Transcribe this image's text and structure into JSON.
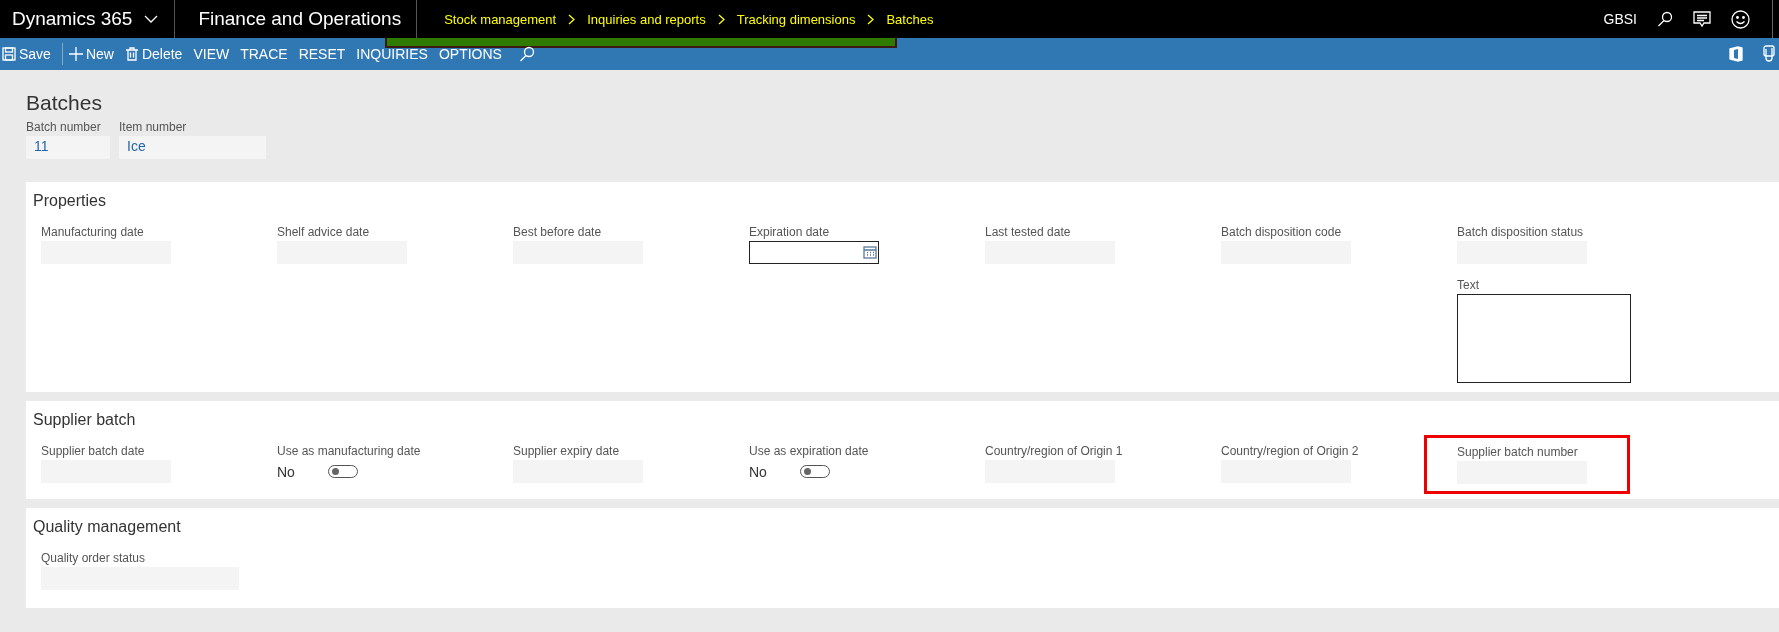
{
  "nav": {
    "app": "Dynamics 365",
    "module": "Finance and Operations",
    "breadcrumb": [
      "Stock management",
      "Inquiries and reports",
      "Tracking dimensions",
      "Batches"
    ],
    "user": "GBSI"
  },
  "toolbar": [
    {
      "label": "Save",
      "kind": "save"
    },
    {
      "label": "New",
      "kind": "new"
    },
    {
      "label": "Delete",
      "kind": "delete"
    },
    {
      "label": "VIEW",
      "kind": "menu"
    },
    {
      "label": "TRACE",
      "kind": "menu"
    },
    {
      "label": "RESET",
      "kind": "menu"
    },
    {
      "label": "INQUIRIES",
      "kind": "menu"
    },
    {
      "label": "OPTIONS",
      "kind": "menu"
    }
  ],
  "page_title": "Batches",
  "header_fields": [
    {
      "label": "Batch number",
      "value": "11"
    },
    {
      "label": "Item number",
      "value": "Ice"
    }
  ],
  "sections": [
    {
      "title": "Properties",
      "fields": [
        {
          "label": "Manufacturing date",
          "kind": "text",
          "highlighted": false
        },
        {
          "label": "Shelf advice date",
          "kind": "text",
          "highlighted": false
        },
        {
          "label": "Best before date",
          "kind": "text",
          "highlighted": false
        },
        {
          "label": "Expiration date",
          "kind": "date",
          "highlighted": false
        },
        {
          "label": "Last tested date",
          "kind": "text",
          "highlighted": false
        },
        {
          "label": "Batch disposition code",
          "kind": "text",
          "highlighted": false
        },
        {
          "label": "Batch disposition status",
          "kind": "text",
          "highlighted": false,
          "extra": {
            "label": "Text",
            "kind": "textarea"
          }
        }
      ]
    },
    {
      "title": "Supplier batch",
      "fields": [
        {
          "label": "Supplier batch date",
          "kind": "text",
          "highlighted": false
        },
        {
          "label": "Use as manufacturing date",
          "kind": "toggle",
          "value": "No",
          "on": false,
          "highlighted": false
        },
        {
          "label": "Supplier expiry date",
          "kind": "text",
          "highlighted": false
        },
        {
          "label": "Use as expiration date",
          "kind": "toggle",
          "value": "No",
          "on": false,
          "highlighted": false
        },
        {
          "label": "Country/region of Origin 1",
          "kind": "text",
          "highlighted": false
        },
        {
          "label": "Country/region of Origin 2",
          "kind": "text",
          "highlighted": false
        },
        {
          "label": "Supplier batch number",
          "kind": "text",
          "highlighted": true
        }
      ]
    },
    {
      "title": "Quality management",
      "fields": [
        {
          "label": "Quality order status",
          "kind": "wide",
          "highlighted": false
        }
      ]
    }
  ]
}
